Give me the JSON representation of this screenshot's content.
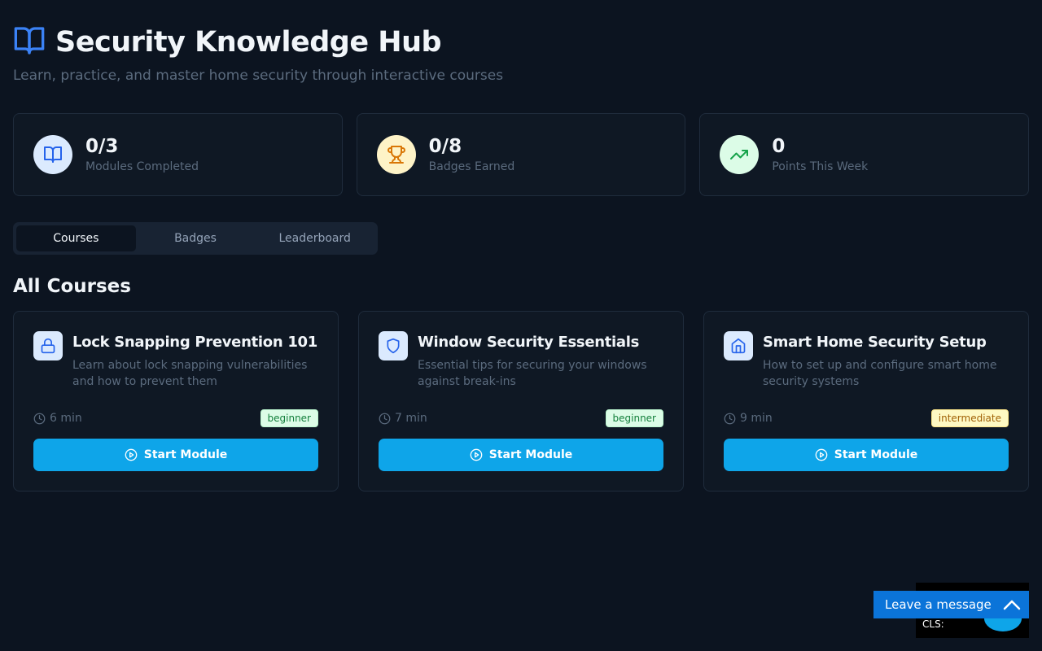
{
  "header": {
    "title": "Security Knowledge Hub",
    "subtitle": "Learn, practice, and master home security through interactive courses",
    "icon": "book-open-icon",
    "accent": "#3b82f6"
  },
  "stats": [
    {
      "value": "0/3",
      "label": "Modules Completed",
      "icon": "book-open-icon",
      "icon_bg": "#dbeafe",
      "icon_color": "#2563eb"
    },
    {
      "value": "0/8",
      "label": "Badges Earned",
      "icon": "trophy-icon",
      "icon_bg": "#fef3c7",
      "icon_color": "#d97706"
    },
    {
      "value": "0",
      "label": "Points This Week",
      "icon": "trending-up-icon",
      "icon_bg": "#dcfce7",
      "icon_color": "#16a34a"
    }
  ],
  "tabs": [
    {
      "label": "Courses",
      "active": true
    },
    {
      "label": "Badges",
      "active": false
    },
    {
      "label": "Leaderboard",
      "active": false
    }
  ],
  "section_title": "All Courses",
  "courses": [
    {
      "title": "Lock Snapping Prevention 101",
      "description": "Learn about lock snapping vulnerabilities and how to prevent them",
      "duration": "6 min",
      "level": "beginner",
      "icon": "lock-icon",
      "button": "Start Module"
    },
    {
      "title": "Window Security Essentials",
      "description": "Essential tips for securing your windows against break-ins",
      "duration": "7 min",
      "level": "beginner",
      "icon": "shield-icon",
      "button": "Start Module"
    },
    {
      "title": "Smart Home Security Setup",
      "description": "How to set up and configure smart home security systems",
      "duration": "9 min",
      "level": "intermediate",
      "icon": "home-icon",
      "button": "Start Module"
    }
  ],
  "widgets": {
    "perf_label": "CLS:",
    "chat_label": "Leave a message"
  },
  "colors": {
    "background": "#0c1420",
    "card": "#0f1824",
    "button": "#0ea5e9"
  }
}
